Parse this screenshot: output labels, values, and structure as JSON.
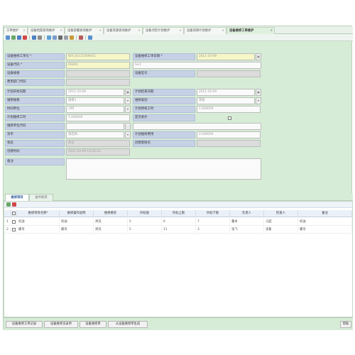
{
  "tabs": [
    {
      "label": "工单维护"
    },
    {
      "label": "设备档案查询维护"
    },
    {
      "label": "设备部署查询维护"
    },
    {
      "label": "设备资源查询维护"
    },
    {
      "label": "设备点检计划维护"
    },
    {
      "label": "设备润滑计划维护"
    },
    {
      "label": "设备维修工单维护"
    }
  ],
  "form": {
    "work_order_no": {
      "label": "设备维修工单号 *",
      "value": "WX-20111009001"
    },
    "work_order_date": {
      "label": "设备维修工单日期 *",
      "value": "2011-10-09"
    },
    "equipment_code": {
      "label": "设备代码 *",
      "value": "DS001"
    },
    "equipment_name": {
      "label": "",
      "value": "test"
    },
    "equipment_spec": {
      "label": "设备规格",
      "value": ""
    },
    "equipment_model": {
      "label": "设备型号",
      "value": ""
    },
    "cost_dept_code": {
      "label": "费用部门代码",
      "value": ""
    },
    "plan_start_date": {
      "label": "计划开始日期",
      "value": "2011-10-09"
    },
    "plan_end_date": {
      "label": "计划结束日期",
      "value": "2011-10-09"
    },
    "repair_spec": {
      "label": "维修规格",
      "value": "规格1"
    },
    "repair_type": {
      "label": "维修类别",
      "value": "等级"
    },
    "time_unit": {
      "label": "时间单位",
      "value": "小时"
    },
    "plan_downtime": {
      "label": "计划停机工时",
      "value": "1.000000"
    },
    "plan_repair_hours": {
      "label": "计划维修工时",
      "value": "1.000000"
    },
    "outsourced": {
      "label": "是否委外"
    },
    "repair_unit_code": {
      "label": "维修单位代码",
      "value": ""
    },
    "currency": {
      "label": "货币",
      "value": "请选择..."
    },
    "plan_repair_cost": {
      "label": "计划维修费用",
      "value": "0.000000"
    },
    "status": {
      "label": "状态",
      "value": "开立"
    },
    "creator": {
      "label": "创建者姓名",
      "value": ""
    },
    "created_time": {
      "label": "创建时间",
      "value": "2011-10-09 10:50:23"
    },
    "remarks": {
      "label": "备注",
      "value": ""
    }
  },
  "detail_tabs": [
    {
      "label": "维修项目"
    },
    {
      "label": "备件耗用"
    }
  ],
  "grid": {
    "columns": [
      "维修项目名称*",
      "维修操作说明",
      "维修要求",
      "目标值",
      "目标上限",
      "目标下限",
      "负责人",
      "检查人",
      "备注"
    ],
    "rows": [
      {
        "no": "1",
        "cells": [
          "机油",
          "机油",
          "清洗",
          "5",
          "6",
          "7",
          "董卓",
          "马超",
          "机油"
        ]
      },
      {
        "no": "2",
        "cells": [
          "螺母",
          "螺母",
          "清洗",
          "5",
          "11",
          "3",
          "张飞",
          "张鲁",
          "螺母"
        ]
      }
    ]
  },
  "buttons": {
    "prev_record": "设备维修工单记录",
    "prev_record2": "设备维修记录单",
    "repair_order": "设备维修单",
    "generate": "从设备维修单生成",
    "help": "帮助"
  },
  "colors": {
    "background": "#d6ecd6",
    "label_bg": "#c6d1e6",
    "required_bg": "#f6f7c8",
    "readonly_bg": "#dcdcdc"
  }
}
